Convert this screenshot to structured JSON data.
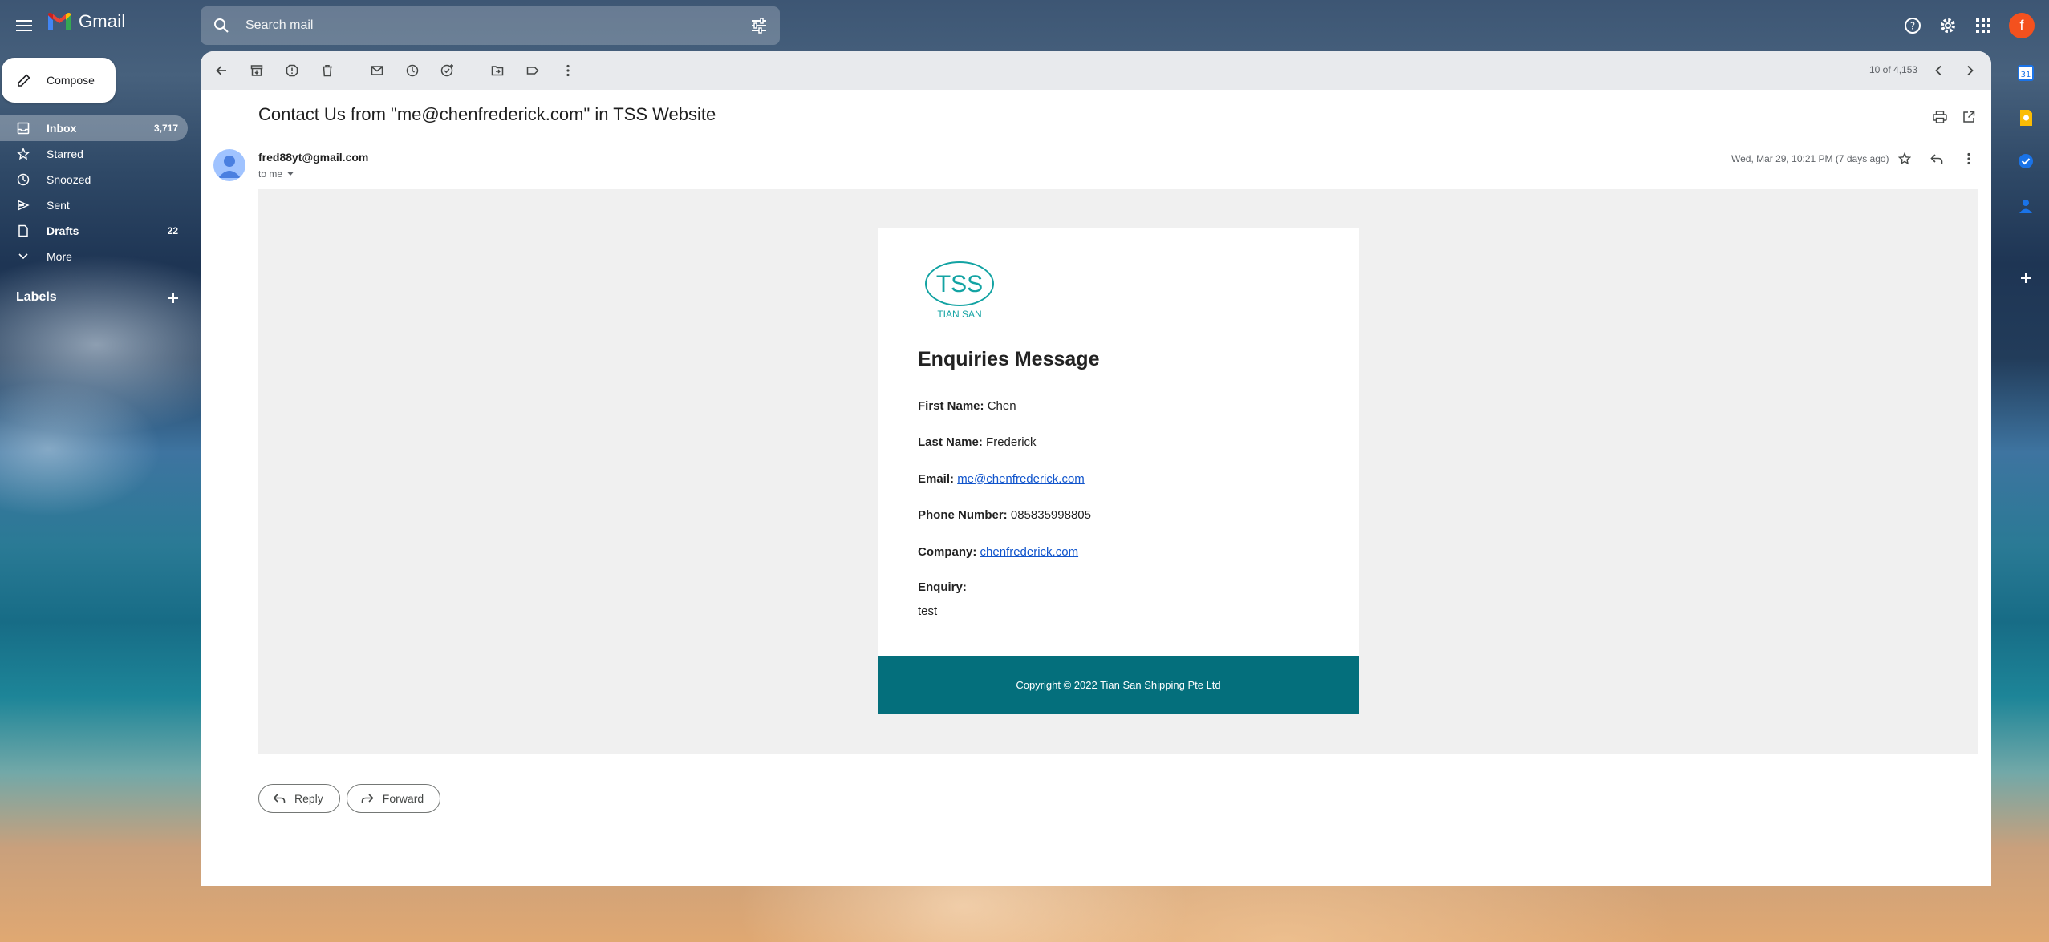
{
  "app": {
    "name": "Gmail",
    "avatar_letter": "f"
  },
  "search": {
    "placeholder": "Search mail"
  },
  "compose": {
    "label": "Compose"
  },
  "nav": {
    "items": [
      {
        "label": "Inbox",
        "count": "3,717",
        "icon": "inbox-icon"
      },
      {
        "label": "Starred",
        "count": "",
        "icon": "star-icon"
      },
      {
        "label": "Snoozed",
        "count": "",
        "icon": "clock-icon"
      },
      {
        "label": "Sent",
        "count": "",
        "icon": "send-icon"
      },
      {
        "label": "Drafts",
        "count": "22",
        "icon": "draft-icon"
      },
      {
        "label": "More",
        "count": "",
        "icon": "chevron-down-icon"
      }
    ],
    "labels_heading": "Labels"
  },
  "toolbar": {
    "pager": "10 of 4,153"
  },
  "message": {
    "subject": "Contact Us from \"me@chenfrederick.com\" in TSS Website",
    "sender": "fred88yt@gmail.com",
    "to": "to me",
    "date": "Wed, Mar 29, 10:21 PM (7 days ago)"
  },
  "email_body": {
    "logo_text": "TSS",
    "logo_subtext": "TIAN SAN",
    "heading": "Enquiries Message",
    "fields": {
      "first_name_label": "First Name:",
      "first_name": "Chen",
      "last_name_label": "Last Name:",
      "last_name": "Frederick",
      "email_label": "Email:",
      "email": "me@chenfrederick.com",
      "phone_label": "Phone Number:",
      "phone": "085835998805",
      "company_label": "Company:",
      "company": "chenfrederick.com",
      "enquiry_label": "Enquiry:",
      "enquiry": "test"
    },
    "footer": "Copyright © 2022 Tian San Shipping Pte Ltd",
    "accent_color": "#046f7c"
  },
  "actions": {
    "reply": "Reply",
    "forward": "Forward"
  }
}
